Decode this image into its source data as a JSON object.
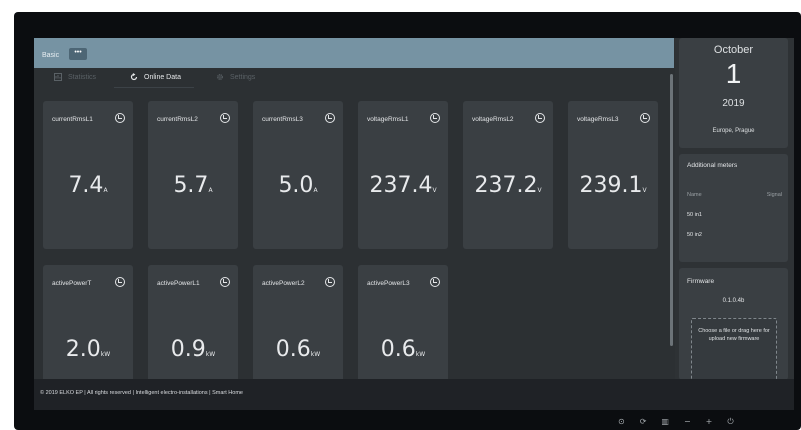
{
  "header": {
    "breadcrumb": "Basic",
    "menu_button": "•••"
  },
  "tabs": [
    {
      "label": "Statistics",
      "icon": "chart-icon",
      "active": false
    },
    {
      "label": "Online Data",
      "icon": "refresh-icon",
      "active": true
    },
    {
      "label": "Settings",
      "icon": "gear-icon",
      "active": false
    }
  ],
  "cards": [
    {
      "title": "currentRmsL1",
      "value": "7.4",
      "unit": "A"
    },
    {
      "title": "currentRmsL2",
      "value": "5.7",
      "unit": "A"
    },
    {
      "title": "currentRmsL3",
      "value": "5.0",
      "unit": "A"
    },
    {
      "title": "voltageRmsL1",
      "value": "237.4",
      "unit": "V"
    },
    {
      "title": "voltageRmsL2",
      "value": "237.2",
      "unit": "V"
    },
    {
      "title": "voltageRmsL3",
      "value": "239.1",
      "unit": "V"
    },
    {
      "title": "activePowerT",
      "value": "2.0",
      "unit": "kW"
    },
    {
      "title": "activePowerL1",
      "value": "0.9",
      "unit": "kW"
    },
    {
      "title": "activePowerL2",
      "value": "0.6",
      "unit": "kW"
    },
    {
      "title": "activePowerL3",
      "value": "0.6",
      "unit": "kW"
    }
  ],
  "date": {
    "month": "October",
    "day": "1",
    "year": "2019",
    "timezone": "Europe, Prague"
  },
  "meters": {
    "title": "Additional meters",
    "col_name": "Name",
    "col_signal": "Signal",
    "rows": [
      "50 in1",
      "50 in2"
    ]
  },
  "firmware": {
    "title": "Firmware",
    "version": "0.1.0.4b",
    "dropzone_text": "Choose a file or drag here for upload new firmware"
  },
  "footer": {
    "text": "© 2019 ELKO EP | All rights reserved | Intelligent electro-installations | Smart Home"
  },
  "bezel": {
    "controls": [
      "⊙",
      "⟳",
      "▥",
      "−",
      "+",
      "⏻"
    ]
  },
  "colors": {
    "header_bar": "#7693a3",
    "card_bg": "#3a3f43",
    "screen_bg": "#2c3033"
  }
}
